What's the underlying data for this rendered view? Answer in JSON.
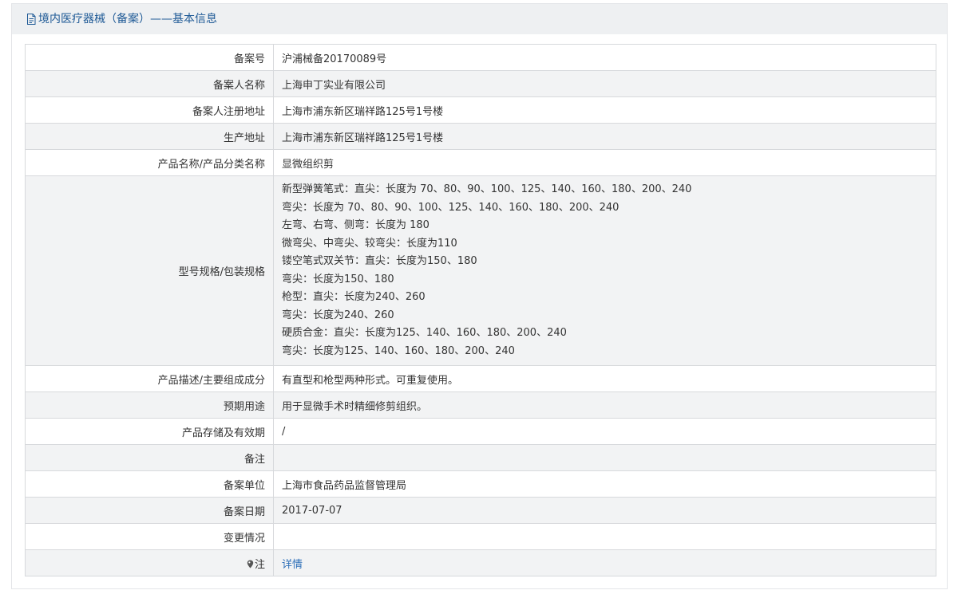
{
  "header": {
    "title": "境内医疗器械（备案）——基本信息",
    "icon": "document-icon"
  },
  "rows": [
    {
      "label": "备案号",
      "value": "沪浦械备20170089号"
    },
    {
      "label": "备案人名称",
      "value": "上海申丁实业有限公司"
    },
    {
      "label": "备案人注册地址",
      "value": "上海市浦东新区瑞祥路125号1号楼"
    },
    {
      "label": "生产地址",
      "value": "上海市浦东新区瑞祥路125号1号楼"
    },
    {
      "label": "产品名称/产品分类名称",
      "value": "显微组织剪"
    }
  ],
  "spec": {
    "label": "型号规格/包装规格",
    "lines": [
      "新型弹簧笔式：直尖：长度为 70、80、90、100、125、140、160、180、200、240",
      "弯尖：长度为 70、80、90、100、125、140、160、180、200、240",
      "左弯、右弯、侧弯：长度为 180",
      "微弯尖、中弯尖、较弯尖：长度为110",
      "镂空笔式双关节：直尖：长度为150、180",
      "弯尖：长度为150、180",
      "枪型：直尖：长度为240、260",
      "弯尖：长度为240、260",
      "硬质合金：直尖：长度为125、140、160、180、200、240",
      "弯尖：长度为125、140、160、180、200、240"
    ]
  },
  "rows2": [
    {
      "label": "产品描述/主要组成成分",
      "value": "有直型和枪型两种形式。可重复使用。"
    },
    {
      "label": "预期用途",
      "value": "用于显微手术时精细修剪组织。"
    },
    {
      "label": "产品存储及有效期",
      "value": "/"
    },
    {
      "label": "备注",
      "value": ""
    },
    {
      "label": "备案单位",
      "value": "上海市食品药品监督管理局"
    },
    {
      "label": "备案日期",
      "value": "2017-07-07"
    },
    {
      "label": "变更情况",
      "value": ""
    }
  ],
  "note": {
    "label": "注",
    "icon": "pin-icon",
    "link_text": "详情"
  },
  "colors": {
    "title": "#1f5a96",
    "link": "#2d6fb8",
    "border": "#d7d9dc",
    "stripe": "#f2f3f4"
  }
}
